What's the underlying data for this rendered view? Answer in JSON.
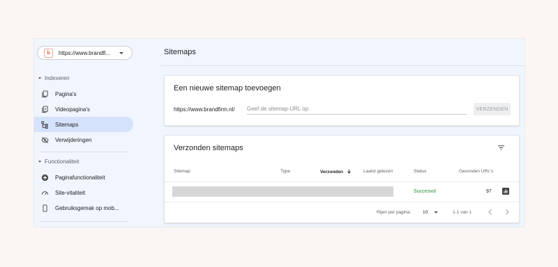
{
  "property": {
    "logo_letter": "b",
    "url": "https://www.brandfi..."
  },
  "sidebar": {
    "sections": [
      {
        "label": "Indexeren"
      },
      {
        "label": "Functionaliteit"
      }
    ],
    "items": [
      {
        "label": "Pagina's",
        "icon": "pages-icon"
      },
      {
        "label": "Videopagina's",
        "icon": "video-pages-icon"
      },
      {
        "label": "Sitemaps",
        "icon": "sitemap-icon",
        "active": true
      },
      {
        "label": "Verwijderingen",
        "icon": "removals-icon"
      },
      {
        "label": "Paginafunctionaliteit",
        "icon": "page-experience-icon"
      },
      {
        "label": "Site-vitaliteit",
        "icon": "core-vitals-icon"
      },
      {
        "label": "Gebruiksgemak op mob...",
        "icon": "mobile-icon"
      }
    ]
  },
  "main": {
    "title": "Sitemaps",
    "add_card": {
      "title": "Een nieuwe sitemap toevoegen",
      "prefix": "https://www.brandfirm.nl/",
      "placeholder": "Geef de sitemap-URL op",
      "submit_label": "VERZENDEN"
    },
    "submitted_card": {
      "title": "Verzonden sitemaps",
      "columns": [
        "Sitemap",
        "Type",
        "Verzonden",
        "Laatst gelezen",
        "Status",
        "Gevonden URL's"
      ],
      "rows": [
        {
          "sitemap": "",
          "type": "",
          "submitted": "",
          "last_read": "",
          "status": "Succesvol",
          "urls": "97"
        }
      ],
      "pagination": {
        "rows_per_page_label": "Rijen per pagina:",
        "rows_per_page": "10",
        "range": "1-1 van 1"
      }
    }
  },
  "colors": {
    "accent": "#d4e3fb",
    "success": "#1e8e3e",
    "logo": "#e05a37"
  }
}
